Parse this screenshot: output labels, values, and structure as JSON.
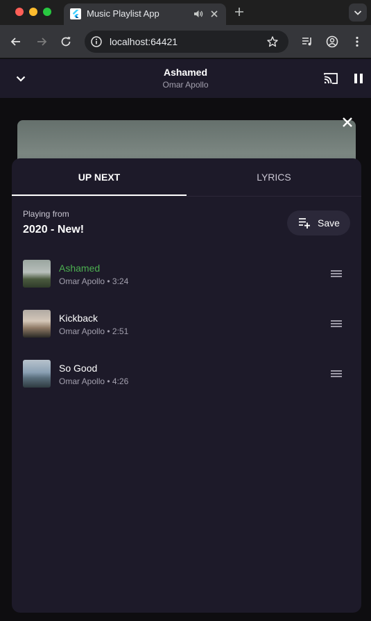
{
  "browser": {
    "tab_title": "Music Playlist App",
    "url": "localhost:64421"
  },
  "now_playing": {
    "title": "Ashamed",
    "artist": "Omar Apollo"
  },
  "sheet": {
    "tabs": [
      "UP NEXT",
      "LYRICS"
    ],
    "active_tab": "UP NEXT",
    "playing_from_label": "Playing from",
    "playlist_name": "2020 - New!",
    "save_label": "Save",
    "tracks": [
      {
        "title": "Ashamed",
        "subtitle": "Omar Apollo • 3:24",
        "active": true
      },
      {
        "title": "Kickback",
        "subtitle": "Omar Apollo • 2:51",
        "active": false
      },
      {
        "title": "So Good",
        "subtitle": "Omar Apollo • 4:26",
        "active": false
      }
    ]
  },
  "colors": {
    "app_background": "#1d1a29",
    "accent_active_track": "#4caf50",
    "save_button": "#2b2839"
  }
}
